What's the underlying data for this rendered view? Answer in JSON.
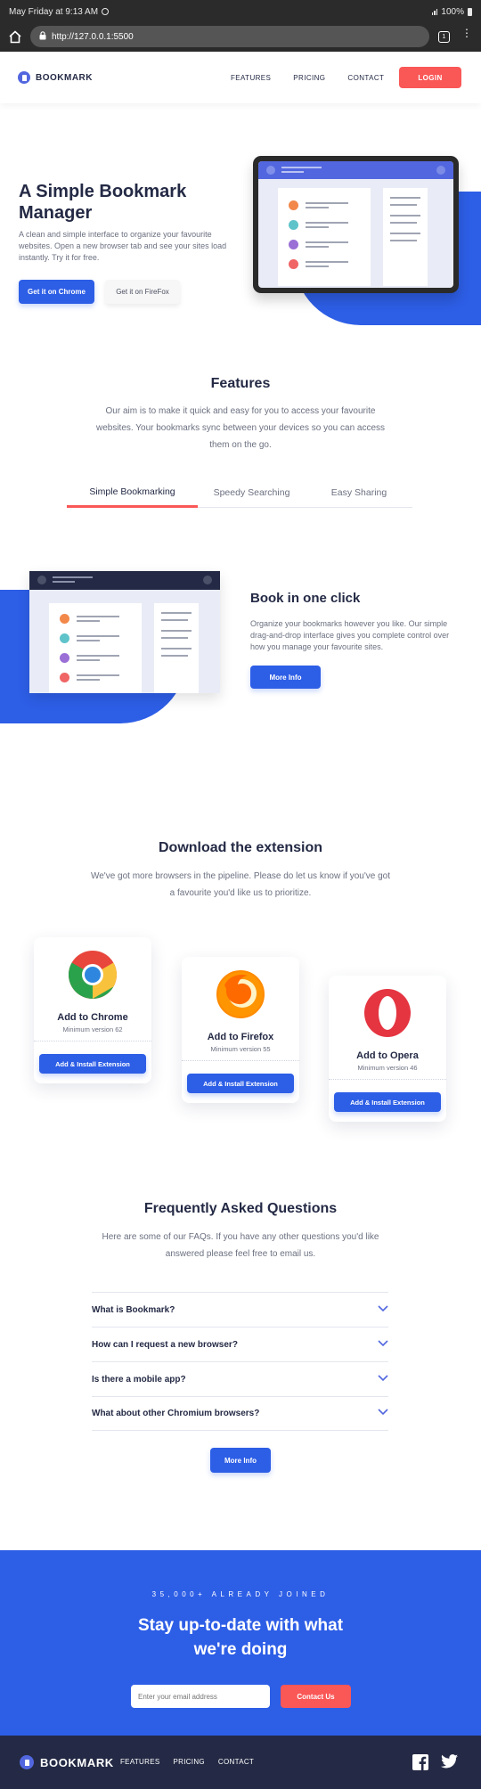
{
  "statusbar": {
    "time": "May Friday at 9:13 AM",
    "battery": "100%"
  },
  "browser": {
    "url": "http://127.0.0.1:5500",
    "tab_count": "1"
  },
  "nav": {
    "brand": "BOOKMARK",
    "links": [
      "FEATURES",
      "PRICING",
      "CONTACT"
    ],
    "login": "LOGIN"
  },
  "hero": {
    "title": "A Simple Bookmark Manager",
    "description": "A clean and simple interface to organize your favourite websites. Open a new browser tab and see your sites load instantly. Try it for free.",
    "btn_chrome": "Get it on Chrome",
    "btn_firefox": "Get it on FireFox"
  },
  "features": {
    "title": "Features",
    "description": "Our aim is to make it quick and easy for you to access your favourite websites. Your bookmarks sync between your devices so you can access them on the go.",
    "tabs": [
      {
        "label": "Simple Bookmarking",
        "active": true
      },
      {
        "label": "Speedy Searching",
        "active": false
      },
      {
        "label": "Easy Sharing",
        "active": false
      }
    ],
    "panel": {
      "title": "Book in one click",
      "description": "Organize your bookmarks however you like. Our simple drag-and-drop interface gives you complete control over how you manage your favourite sites.",
      "button": "More Info"
    }
  },
  "download": {
    "title": "Download the extension",
    "description": "We've got more browsers in the pipeline. Please do let us know if you've got a favourite you'd like us to prioritize.",
    "cards": [
      {
        "title": "Add to Chrome",
        "version": "Minimum version 62",
        "button": "Add & Install Extension",
        "icon": "chrome-icon"
      },
      {
        "title": "Add to Firefox",
        "version": "Minimum version 55",
        "button": "Add & Install Extension",
        "icon": "firefox-icon"
      },
      {
        "title": "Add to Opera",
        "version": "Minimum version 46",
        "button": "Add & Install Extension",
        "icon": "opera-icon"
      }
    ]
  },
  "faq": {
    "title": "Frequently Asked Questions",
    "description": "Here are some of our FAQs. If you have any other questions you'd like answered please feel free to email us.",
    "items": [
      "What is Bookmark?",
      "How can I request a new browser?",
      "Is there a mobile app?",
      "What about other Chromium browsers?"
    ],
    "button": "More Info"
  },
  "cta": {
    "kicker": "35,000+ ALREADY JOINED",
    "title": "Stay up-to-date with what we're doing",
    "placeholder": "Enter your email address",
    "button": "Contact Us"
  },
  "footer": {
    "brand": "BOOKMARK",
    "links": [
      "FEATURES",
      "PRICING",
      "CONTACT"
    ]
  },
  "colors": {
    "primary_blue": "#2d5ee6",
    "soft_red": "#fa5757",
    "dark_navy": "#242a45",
    "grey_text": "#6b7080"
  }
}
